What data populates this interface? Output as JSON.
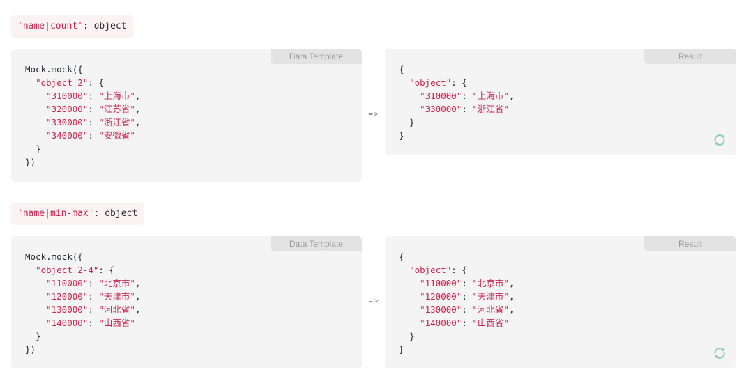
{
  "rules": [
    {
      "badge_key": "'name|count'",
      "badge_sep": ": ",
      "badge_type": "object",
      "template_tab": "Data Template",
      "result_tab": "Result",
      "arrow": "=>",
      "template_lines": [
        {
          "indent": 0,
          "text": "Mock.mock({"
        },
        {
          "indent": 1,
          "key": "\"object|2\"",
          "rest": ": {"
        },
        {
          "indent": 2,
          "key": "\"310000\"",
          "sep": ": ",
          "val": "\"上海市\"",
          "end": ","
        },
        {
          "indent": 2,
          "key": "\"320000\"",
          "sep": ": ",
          "val": "\"江苏省\"",
          "end": ","
        },
        {
          "indent": 2,
          "key": "\"330000\"",
          "sep": ": ",
          "val": "\"浙江省\"",
          "end": ","
        },
        {
          "indent": 2,
          "key": "\"340000\"",
          "sep": ": ",
          "val": "\"安徽省\"",
          "end": ""
        },
        {
          "indent": 1,
          "text": "}"
        },
        {
          "indent": 0,
          "text": "})"
        }
      ],
      "result_lines": [
        {
          "indent": 0,
          "text": "{"
        },
        {
          "indent": 1,
          "key": "\"object\"",
          "rest": ": {"
        },
        {
          "indent": 2,
          "key": "\"310000\"",
          "sep": ": ",
          "val": "\"上海市\"",
          "end": ","
        },
        {
          "indent": 2,
          "key": "\"330000\"",
          "sep": ": ",
          "val": "\"浙江省\"",
          "end": ""
        },
        {
          "indent": 1,
          "text": "}"
        },
        {
          "indent": 0,
          "text": "}"
        }
      ],
      "refresh_icon": "refresh-icon"
    },
    {
      "badge_key": "'name|min-max'",
      "badge_sep": ": ",
      "badge_type": "object",
      "template_tab": "Data Template",
      "result_tab": "Result",
      "arrow": "=>",
      "template_lines": [
        {
          "indent": 0,
          "text": "Mock.mock({"
        },
        {
          "indent": 1,
          "key": "\"object|2-4\"",
          "rest": ": {"
        },
        {
          "indent": 2,
          "key": "\"110000\"",
          "sep": ": ",
          "val": "\"北京市\"",
          "end": ","
        },
        {
          "indent": 2,
          "key": "\"120000\"",
          "sep": ": ",
          "val": "\"天津市\"",
          "end": ","
        },
        {
          "indent": 2,
          "key": "\"130000\"",
          "sep": ": ",
          "val": "\"河北省\"",
          "end": ","
        },
        {
          "indent": 2,
          "key": "\"140000\"",
          "sep": ": ",
          "val": "\"山西省\"",
          "end": ""
        },
        {
          "indent": 1,
          "text": "}"
        },
        {
          "indent": 0,
          "text": "})"
        }
      ],
      "result_lines": [
        {
          "indent": 0,
          "text": "{"
        },
        {
          "indent": 1,
          "key": "\"object\"",
          "rest": ": {"
        },
        {
          "indent": 2,
          "key": "\"110000\"",
          "sep": ": ",
          "val": "\"北京市\"",
          "end": ","
        },
        {
          "indent": 2,
          "key": "\"120000\"",
          "sep": ": ",
          "val": "\"天津市\"",
          "end": ","
        },
        {
          "indent": 2,
          "key": "\"130000\"",
          "sep": ": ",
          "val": "\"河北省\"",
          "end": ","
        },
        {
          "indent": 2,
          "key": "\"140000\"",
          "sep": ": ",
          "val": "\"山西省\"",
          "end": ""
        },
        {
          "indent": 1,
          "text": "}"
        },
        {
          "indent": 0,
          "text": "}"
        }
      ],
      "refresh_icon": "refresh-icon"
    }
  ],
  "colors": {
    "string": "#c7254e",
    "text": "#24292e",
    "panel_bg": "#f4f4f4",
    "tab_bg": "#e3e3e3",
    "badge_bg": "#fbf2f4",
    "refresh": "#8fd0b8"
  }
}
